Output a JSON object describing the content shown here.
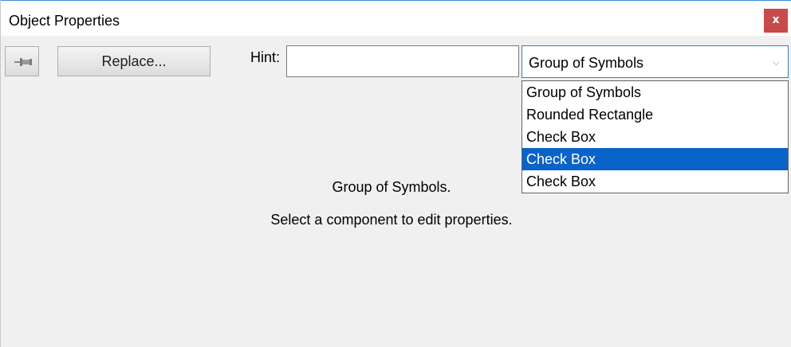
{
  "window": {
    "title": "Object Properties",
    "close_symbol": "x"
  },
  "toolbar": {
    "pin_icon": "pushpin-icon",
    "replace_label": "Replace...",
    "hint_label": "Hint:",
    "hint_value": ""
  },
  "component_select": {
    "selected": "Group of Symbols",
    "arrow_icon": "chevron-down-icon",
    "options": [
      "Group of Symbols",
      "Rounded Rectangle",
      "Check Box",
      "Check Box",
      "Check Box"
    ],
    "highlighted_index": 3
  },
  "body": {
    "message_1": "Group of Symbols.",
    "message_2": "Select a component to edit properties."
  },
  "colors": {
    "close": "#c84a4a",
    "highlight": "#0a63c8",
    "accent": "#3c7fb1"
  }
}
